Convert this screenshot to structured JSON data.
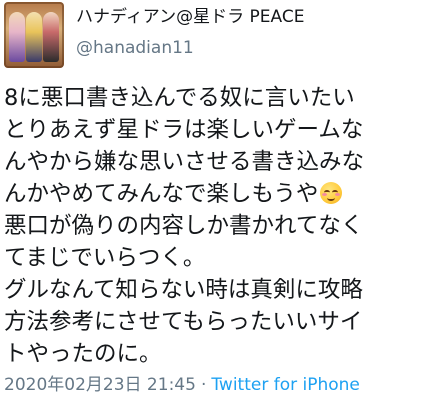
{
  "tweet": {
    "author": {
      "display_name": "ハナディアン@星ドラ PEACE",
      "handle": "@hanadian11"
    },
    "body_lines": [
      "8に悪口書き込んでる奴に言いたい",
      "とりあえず星ドラは楽しいゲームな",
      "んやから嫌な思いさせる書き込みな",
      "んかやめてみんなで楽しもうや",
      "悪口が偽りの内容しか書かれてなく",
      "てまじでいらつく。",
      "グルなんて知らない時は真剣に攻略",
      "方法参考にさせてもらったいいサイ",
      "トやったのに。"
    ],
    "emoji_icon": "smiling-face-with-smiling-eyes-icon",
    "timestamp": "2020年02月23日 21:45",
    "separator": "·",
    "source": "Twitter for iPhone",
    "colors": {
      "text": "#14171a",
      "secondary": "#657786",
      "link": "#1da1f2"
    }
  }
}
